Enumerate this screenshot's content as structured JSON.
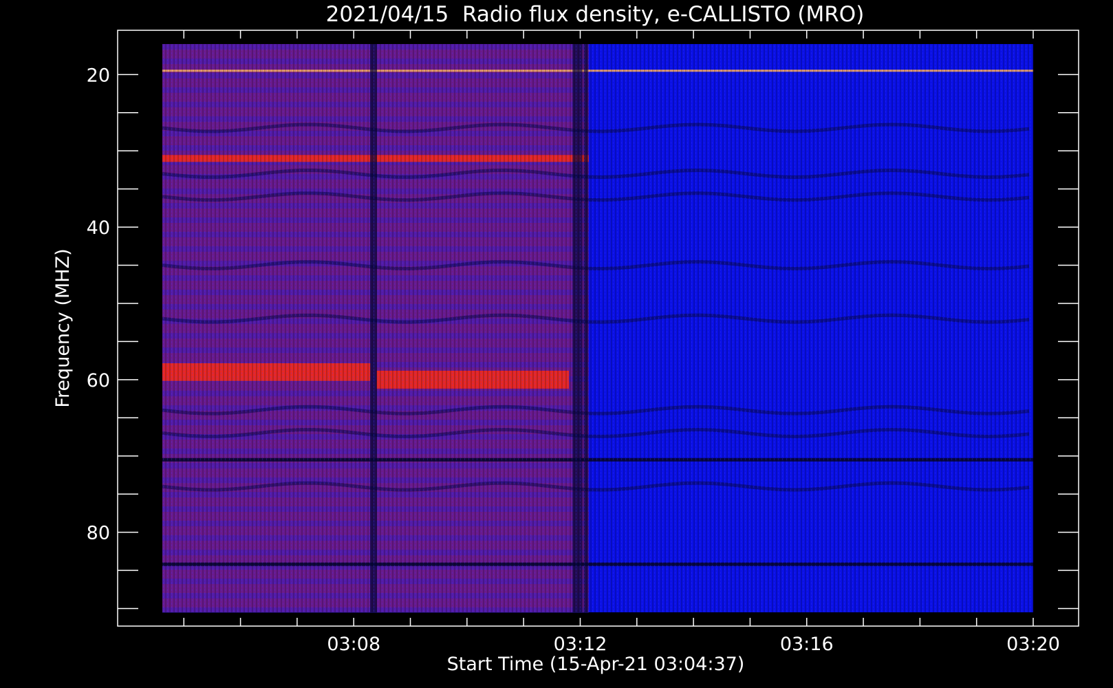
{
  "chart_data": {
    "type": "heatmap",
    "title": "2021/04/15  Radio flux density, e-CALLISTO (MRO)",
    "xlabel": "Start Time (15-Apr-21 03:04:37)",
    "ylabel": "Frequency (MHZ)",
    "x_tick_labels": [
      "03:08",
      "03:12",
      "03:16",
      "03:20"
    ],
    "x_ticks_minutes_after_0300": [
      8,
      12,
      16,
      20
    ],
    "x_range_minutes_after_0300": [
      4.62,
      20.0
    ],
    "y_tick_labels": [
      "20",
      "40",
      "60",
      "80"
    ],
    "y_ticks": [
      20,
      40,
      60,
      80
    ],
    "y_range": [
      16,
      90.5
    ],
    "y_inverted": true,
    "colors": {
      "background": "#000000",
      "low": "#0a10e6",
      "mid": "#6a1a8c",
      "high": "#ff2a10",
      "spike": "#ffb060"
    },
    "features": [
      {
        "name": "left-segment",
        "t_start": 4.62,
        "t_end": 12.15,
        "level": "mid"
      },
      {
        "name": "right-segment",
        "t_start": 12.15,
        "t_end": 20.0,
        "level": "low"
      },
      {
        "name": "band-31MHz",
        "freq": 31,
        "level": "high",
        "t_start": 4.62,
        "t_end": 12.15
      },
      {
        "name": "band-59MHz-a",
        "freq": 59,
        "level": "high",
        "t_start": 4.62,
        "t_end": 8.3
      },
      {
        "name": "band-60MHz-b",
        "freq": 60,
        "level": "high",
        "t_start": 8.4,
        "t_end": 11.8
      },
      {
        "name": "dark-line-70MHz",
        "freq": 70.5,
        "level": "dark"
      },
      {
        "name": "dark-line-84MHz",
        "freq": 84.2,
        "level": "dark"
      },
      {
        "name": "spike-line-19.5MHz",
        "freq": 19.5,
        "level": "spike"
      }
    ]
  }
}
